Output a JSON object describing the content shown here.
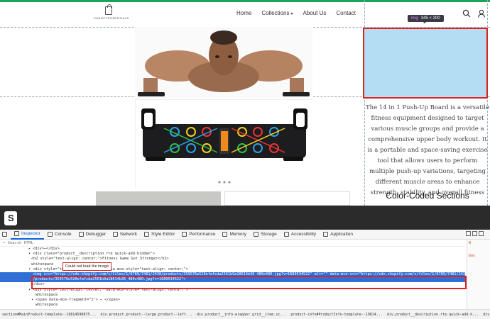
{
  "header": {
    "logo_text": "CANOPYESSENTIALS",
    "nav": [
      "Home",
      "Collections",
      "About Us",
      "Contact"
    ],
    "icons": [
      "search-icon",
      "user-icon"
    ]
  },
  "colors": {
    "accent": "#1aa35a",
    "highlight": "#d22222",
    "selection": "#2f6fd6",
    "image_overlay": "#b4dcf2"
  },
  "tooltip": {
    "tag": "img",
    "size": "345 × 200"
  },
  "description": "The 14 in 1 Push-Up Board is a versatile fitness equipment designed to target various muscle groups and provide a comprehensive upper body workout. It is a portable and space-saving exercise tool that allows users to perform multiple push-up variations, targeting different muscle areas to enhance strength, stability, and overall fitness",
  "section_title": "Color-Coded Sections",
  "devtools": {
    "tabs": [
      "Inspector",
      "Console",
      "Debugger",
      "Network",
      "Style Editor",
      "Performance",
      "Memory",
      "Storage",
      "Accessibility",
      "Application"
    ],
    "search_placeholder": "Search HTML",
    "code_lines": [
      "▸ <div>⋯</div>",
      "▾ <div class=\"product__description rte quick-add-hidden\">",
      "    <h2 style=\"text-align: center;\">Fitness Game Got Stronger</h2>",
      "    whitespace",
      "  ▾ <div style=\"text-align: center;\" data-mce-style=\"text-align: center;\">",
      "      <img src=\"https://cdn.shopify.com/s/files/1/0789/7481/2438/products/359576e520efafcda2561b9a18614b36_480x480.jpg?v=1689534522\" alt=\"\" data-mce-src=\"https://cdn.shopify.com/s/files/1/0789/7481/2438",
      "      /products/359576e520efafcda2561b9a18614b36_480x480.jpg?v=1689534522\">",
      "    </div>",
      "  ▾ <div style=\"text-align: center;\" data-mce-style=\"text-align: center;\">",
      "      whitespace",
      "    ▾ <span data-mce-fragment=\"1\"> ⋯ </span>",
      "      whitespace"
    ],
    "error_tip": "Could not load the image",
    "side_panel": [
      "R",
      "box"
    ],
    "breadcrumb": [
      "section#MainProduct-template--19814590875...",
      "div.product.product--large.product--left...",
      "div.product__info-wrapper.grid__item.sc...",
      "product-info#ProductInfo-template--19814...",
      "div.product__description.rte.quick-add-h...",
      "div"
    ]
  }
}
